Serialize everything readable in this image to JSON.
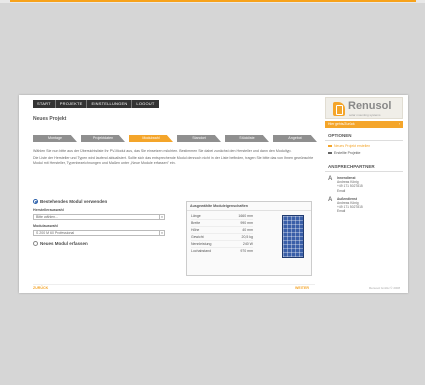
{
  "nav": [
    "START",
    "PROJEKTE",
    "EINSTELLUNGEN",
    "LOGOUT"
  ],
  "logo": {
    "name": "Renusol",
    "tagline": "solar mounting systems"
  },
  "page_title": "Neues Projekt",
  "tabs": [
    {
      "label": "Montage",
      "active": false
    },
    {
      "label": "Projektdaten",
      "active": false
    },
    {
      "label": "Modulwahl",
      "active": true
    },
    {
      "label": "Standort",
      "active": false
    },
    {
      "label": "Stückliste",
      "active": false
    },
    {
      "label": "Angebot",
      "active": false
    }
  ],
  "intro": [
    "Wählen Sie nun bitte aus der Übersichtsliste Ihr PV-Modul aus, das Sie einsetzen möchten. Bestimmen Sie dabei zunächst den Hersteller und dann den Modultyp.",
    "Die Liste der Hersteller und Typen wird laufend aktualisiert. Sollte sich das entsprechende Modul dennoch nicht in der Liste befinden, tragen Sie bitte das von Ihnen gewünschte Modul mit Hersteller, Typenbezeichnungen und Maßen unter „Neue Module erfassen\" ein."
  ],
  "option_existing": "Bestehendes Modul verwenden",
  "manufacturer_label": "Herstellerauswahl",
  "manufacturer_value": "Bitte wählen...",
  "module_label": "Modulauswahl",
  "module_value": "S 200 M 60 Professional",
  "option_new": "Neues Modul erfassen",
  "props": {
    "title": "Ausgewählte Moduleigenschaften",
    "rows": [
      {
        "label": "Länge",
        "value": "1660 mm"
      },
      {
        "label": "Breite",
        "value": "990 mm"
      },
      {
        "label": "Höhe",
        "value": "40 mm"
      },
      {
        "label": "Gewicht",
        "value": "20,5 kg"
      },
      {
        "label": "Nennleistung",
        "value": "240 W"
      },
      {
        "label": "Lochabstand",
        "value": "970 mm"
      }
    ]
  },
  "footer": {
    "back": "ZURÜCK",
    "next": "WEITER",
    "copyright": "Renusol GmbH © 2008"
  },
  "sidebar": {
    "bar_label": "Hier gehts/Zurück",
    "options_title": "OPTIONEN",
    "options": [
      {
        "label": "Neues Projekt erstellen",
        "highlight": true
      },
      {
        "label": "Erstellte Projekte",
        "highlight": false
      }
    ],
    "contacts_title": "ANSPRECHPARTNER",
    "contacts": [
      {
        "role": "Innendienst",
        "name": "Andreas König",
        "phone": "+49 171 5027815",
        "email": "Email"
      },
      {
        "role": "Außendienst",
        "name": "Andreas König",
        "phone": "+49 171 5027815",
        "email": "Email"
      }
    ]
  },
  "colors": {
    "accent": "#f4a52a",
    "panel": "#3a5fa8",
    "tab": "#8f8f8f"
  }
}
